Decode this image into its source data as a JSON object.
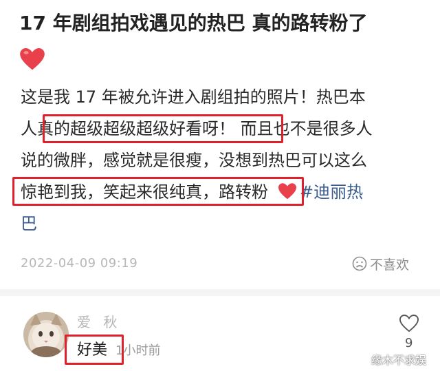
{
  "post": {
    "title": "17 年剧组拍戏遇见的热巴 真的路转粉了",
    "body_lines": [
      "这是我 17 年被允许进入剧组拍的照片！热巴本",
      "人真的超级超级超级好看呀！ 而且也不是很多人",
      "说的微胖，感觉就是很瘦，没想到热巴可以这么",
      "惊艳到我，笑起来很纯真，路转粉"
    ],
    "hashtag": "#迪丽热",
    "hashtag_tail": "巴",
    "date": "2022-04-09 09:19",
    "dislike_label": "不喜欢"
  },
  "comment": {
    "username": "爱  秋",
    "text": "好美",
    "time": "1小时前",
    "like_count": "9"
  },
  "watermark": "缘木不求娱",
  "colors": {
    "highlight_box": "#e0202a",
    "heart": "#e8414b",
    "hashtag": "#3b5d8f"
  },
  "icons": [
    "heart-icon",
    "sad-face-icon",
    "like-heart-icon"
  ]
}
